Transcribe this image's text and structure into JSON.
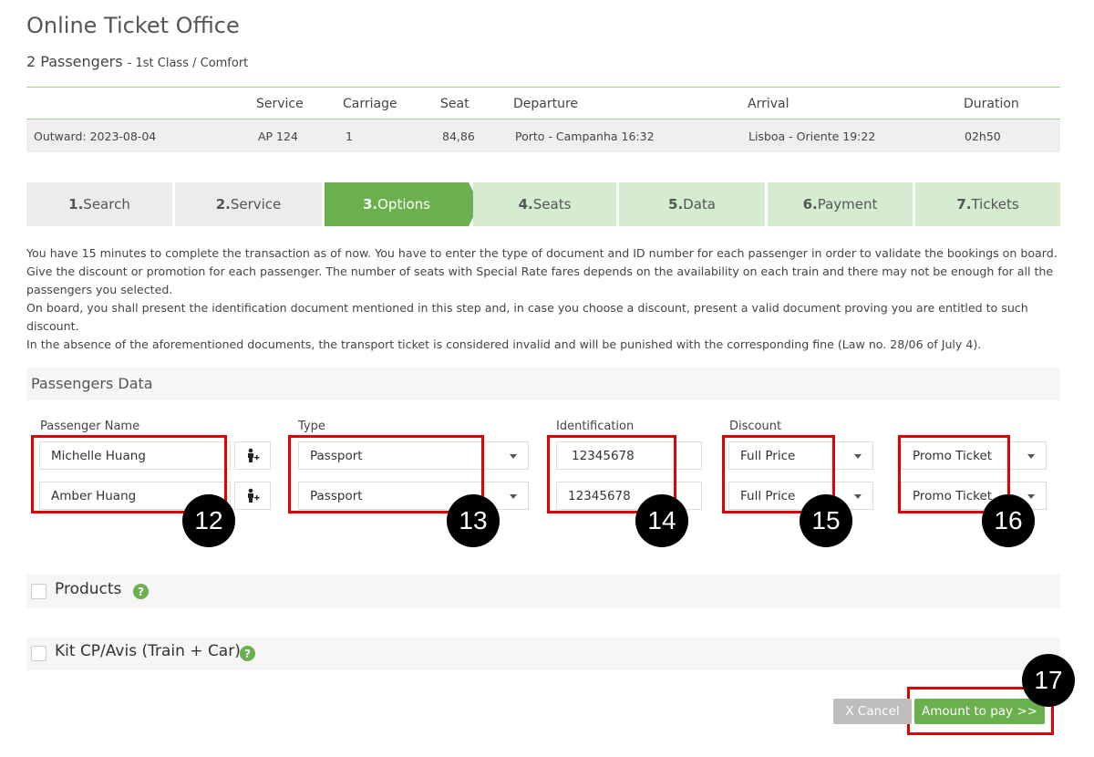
{
  "page": {
    "title": "Online Ticket Office",
    "passengers_count": "2 Passengers",
    "class_info": "- 1st Class / Comfort"
  },
  "trip": {
    "headers": [
      "Service",
      "Carriage",
      "Seat",
      "Departure",
      "Arrival",
      "Duration"
    ],
    "row": {
      "label": "Outward: 2023-08-04",
      "service": "AP 124",
      "carriage": "1",
      "seat": "84,86",
      "departure": "Porto - Campanha 16:32",
      "arrival": "Lisboa - Oriente 19:22",
      "duration": "02h50"
    }
  },
  "steps": [
    {
      "num": "1.",
      "label": "Search"
    },
    {
      "num": "2.",
      "label": "Service"
    },
    {
      "num": "3.",
      "label": "Options"
    },
    {
      "num": "4.",
      "label": "Seats"
    },
    {
      "num": "5.",
      "label": "Data"
    },
    {
      "num": "6.",
      "label": "Payment"
    },
    {
      "num": "7.",
      "label": "Tickets"
    }
  ],
  "info": [
    "You have 15 minutes to complete the transaction as of now. You have to enter the type of document and ID number for each passenger in order to validate the bookings on board. Give the discount or promotion for each passenger. The number of seats with Special Rate fares depends on the availability on each train and there may not be enough for all the passengers you selected.",
    "On board, you shall present the identification document mentioned in this step and, in case you choose a discount, present a valid document proving you are entitled to such discount.",
    "In the absence of the aforementioned documents, the transport ticket is considered invalid and will be punished with the corresponding fine (Law no. 28/06 of July 4)."
  ],
  "passengers_data": {
    "header": "Passengers Data",
    "labels": {
      "name": "Passenger Name",
      "type": "Type",
      "identification": "Identification",
      "discount": "Discount"
    },
    "rows": [
      {
        "name": "Michelle Huang",
        "type": "Passport",
        "id": "12345678",
        "discount": "Full Price",
        "promo": "Promo Ticket"
      },
      {
        "name": "Amber Huang",
        "type": "Passport",
        "id": "12345678",
        "discount": "Full Price",
        "promo": "Promo Ticket"
      }
    ]
  },
  "annotations": [
    "12",
    "13",
    "14",
    "15",
    "16",
    "17"
  ],
  "sections": {
    "products": "Products",
    "kit": "Kit CP/Avis (Train + Car)",
    "help_symbol": "?"
  },
  "buttons": {
    "cancel": "X Cancel",
    "pay": "Amount to pay >>"
  },
  "colors": {
    "accent_green": "#6ab04c",
    "step_todo": "#d6ecd0",
    "step_done": "#ececec",
    "annotation_red": "#e00000"
  }
}
